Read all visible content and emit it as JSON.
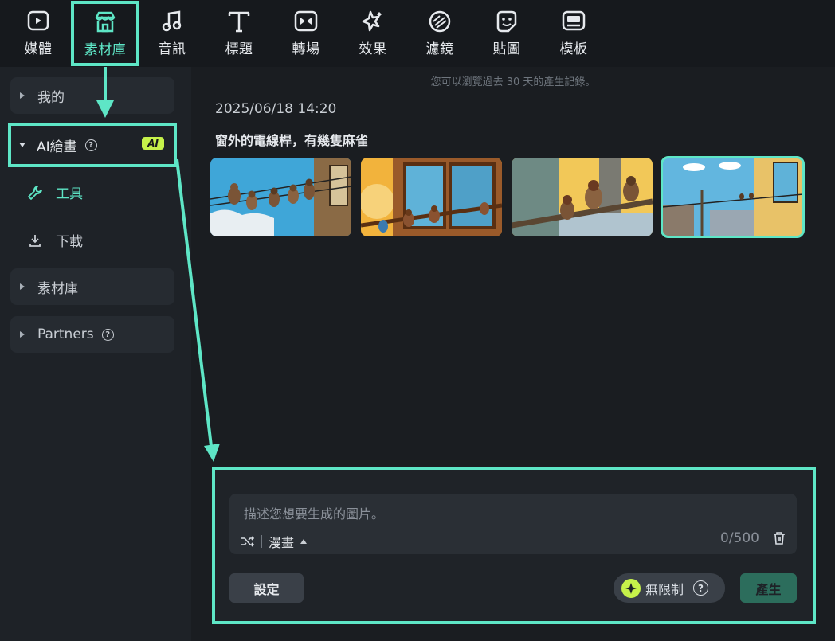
{
  "toolbar": {
    "items": [
      {
        "label": "媒體",
        "icon": "media-icon"
      },
      {
        "label": "素材庫",
        "icon": "store-icon"
      },
      {
        "label": "音訊",
        "icon": "music-icon"
      },
      {
        "label": "標題",
        "icon": "title-icon"
      },
      {
        "label": "轉場",
        "icon": "transition-icon"
      },
      {
        "label": "效果",
        "icon": "effects-icon"
      },
      {
        "label": "濾鏡",
        "icon": "filter-icon"
      },
      {
        "label": "貼圖",
        "icon": "sticker-icon"
      },
      {
        "label": "模板",
        "icon": "template-icon"
      }
    ],
    "active": "素材庫"
  },
  "sidebar": {
    "my": "我的",
    "ai_drawing": "AI繪畫",
    "ai_badge": "AI",
    "tools": "工具",
    "download": "下載",
    "library": "素材庫",
    "partners": "Partners"
  },
  "main": {
    "notice": "您可以瀏覽過去 30 天的產生記錄。",
    "date": "2025/06/18 14:20",
    "prompt": "窗外的電線桿，有幾隻麻雀"
  },
  "composer": {
    "placeholder": "描述您想要生成的圖片。",
    "style": "漫畫",
    "counter": "0/500",
    "settings": "設定",
    "unlimited": "無限制",
    "generate": "產生"
  },
  "colors": {
    "accent": "#5ee6c6",
    "badge": "#c6f24a",
    "generate_bg": "#2c6d5c"
  }
}
